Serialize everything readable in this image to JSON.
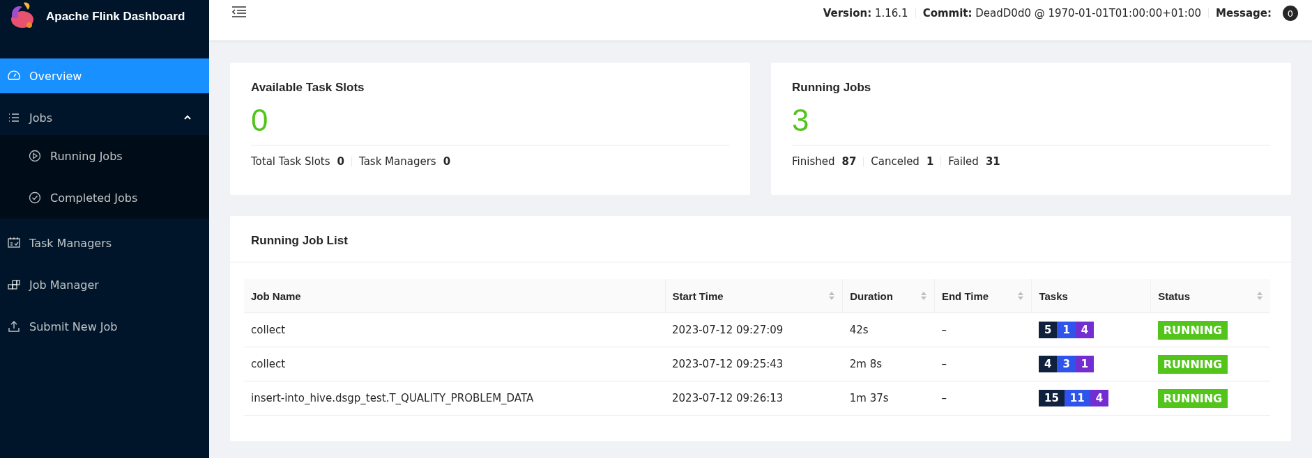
{
  "sidebar": {
    "title": "Apache Flink Dashboard",
    "items": [
      {
        "label": "Overview",
        "selected": true
      },
      {
        "label": "Jobs",
        "selected": false,
        "expanded": true,
        "children": [
          {
            "label": "Running Jobs",
            "selected": false
          },
          {
            "label": "Completed Jobs",
            "selected": false
          }
        ]
      },
      {
        "label": "Task Managers",
        "selected": false
      },
      {
        "label": "Job Manager",
        "selected": false
      },
      {
        "label": "Submit New Job",
        "selected": false
      }
    ]
  },
  "header": {
    "items": [
      {
        "label": "Version:",
        "value": "1.16.1"
      },
      {
        "label": "Commit:",
        "value": "DeadD0d0 @ 1970-01-01T01:00:00+01:00"
      }
    ],
    "message_label": "Message:",
    "message_count": "0"
  },
  "cards": [
    {
      "title": "Available Task Slots",
      "value": "0",
      "stats": [
        {
          "label": "Total Task Slots",
          "value": "0"
        },
        {
          "label": "Task Managers",
          "value": "0"
        }
      ]
    },
    {
      "title": "Running Jobs",
      "value": "3",
      "stats": [
        {
          "label": "Finished",
          "value": "87"
        },
        {
          "label": "Canceled",
          "value": "1"
        },
        {
          "label": "Failed",
          "value": "31"
        }
      ]
    }
  ],
  "job_list": {
    "title": "Running Job List",
    "columns": [
      {
        "label": "Job Name",
        "sortable": false
      },
      {
        "label": "Start Time",
        "sortable": true
      },
      {
        "label": "Duration",
        "sortable": true
      },
      {
        "label": "End Time",
        "sortable": true
      },
      {
        "label": "Tasks",
        "sortable": false
      },
      {
        "label": "Status",
        "sortable": true
      }
    ],
    "rows": [
      {
        "name": "collect",
        "start": "2023-07-12 09:27:09",
        "duration": "42s",
        "end": "–",
        "tasks": [
          {
            "count": "5",
            "color": "#10213e"
          },
          {
            "count": "1",
            "color": "#2f54eb"
          },
          {
            "count": "4",
            "color": "#722ed1"
          }
        ],
        "status": "RUNNING"
      },
      {
        "name": "collect",
        "start": "2023-07-12 09:25:43",
        "duration": "2m 8s",
        "end": "–",
        "tasks": [
          {
            "count": "4",
            "color": "#10213e"
          },
          {
            "count": "3",
            "color": "#2f54eb"
          },
          {
            "count": "1",
            "color": "#722ed1"
          }
        ],
        "status": "RUNNING"
      },
      {
        "name": "insert-into_hive.dsgp_test.T_QUALITY_PROBLEM_DATA",
        "start": "2023-07-12 09:26:13",
        "duration": "1m 37s",
        "end": "–",
        "tasks": [
          {
            "count": "15",
            "color": "#10213e"
          },
          {
            "count": "11",
            "color": "#2f54eb"
          },
          {
            "count": "4",
            "color": "#722ed1"
          }
        ],
        "status": "RUNNING"
      }
    ]
  }
}
